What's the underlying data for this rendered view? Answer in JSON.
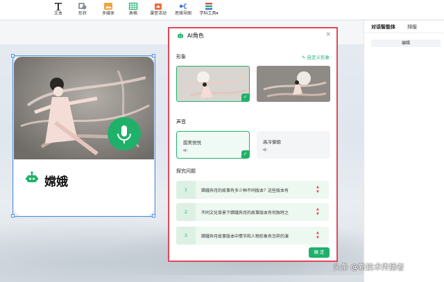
{
  "toolbar": {
    "items": [
      {
        "label": "文本",
        "icon": "text-icon"
      },
      {
        "label": "形状",
        "icon": "shape-icon"
      },
      {
        "label": "多媒体",
        "icon": "media-icon"
      },
      {
        "label": "表格",
        "icon": "table-icon"
      },
      {
        "label": "课堂活动",
        "icon": "activity-icon"
      },
      {
        "label": "思维导图",
        "icon": "mindmap-icon"
      },
      {
        "label": "学科工具",
        "icon": "subject-tools-icon"
      }
    ]
  },
  "card": {
    "name": "嫦娥",
    "icon": "robot-icon",
    "mic": "microphone-icon"
  },
  "right_panel": {
    "tabs": [
      "对话智能体",
      "排版"
    ],
    "edit_label": "编辑"
  },
  "dialog": {
    "title": "AI角色",
    "close": "×",
    "avatar_section": "形象",
    "custom_avatar": "自定义形象",
    "voice_section": "声音",
    "voices": [
      {
        "name": "甜美悦悦",
        "selected": true
      },
      {
        "name": "高冷御姐",
        "selected": false
      }
    ],
    "questions_section": "探究问题",
    "questions": [
      {
        "num": "1",
        "text": "嫦娥奔月的故事有多少种不同版本？这些版本有"
      },
      {
        "num": "2",
        "text": "不同文化背景下嫦娥奔月的故事版本有何独特之"
      },
      {
        "num": "3",
        "text": "嫦娥奔月故事版本中情节和人物形象有怎样的演"
      }
    ],
    "confirm": "确 定"
  },
  "watermark": "头条 @新技术传播者",
  "colors": {
    "accent": "#1fb16a",
    "highlight_border": "#e0475a",
    "selection": "#4a90e2"
  }
}
